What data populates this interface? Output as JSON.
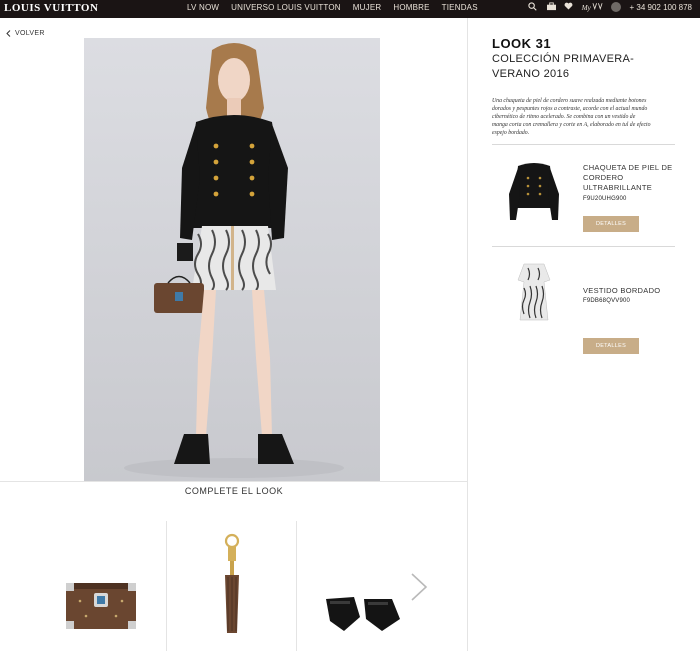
{
  "header": {
    "logo": "LOUIS VUITTON",
    "nav": [
      "LV NOW",
      "UNIVERSO LOUIS VUITTON",
      "MUJER",
      "HOMBRE",
      "TIENDAS"
    ],
    "icons": [
      "search-icon",
      "bag-icon",
      "heart-icon",
      "my-lv-icon",
      "globe-icon"
    ],
    "my_label": "My",
    "phone": "+ 34 902 100 878"
  },
  "back": {
    "label": "VOLVER",
    "icon": "chevron-left-icon"
  },
  "look": {
    "title": "LOOK 31",
    "collection": "COLECCIÓN PRIMAVERA-VERANO 2016",
    "description": "Una chaqueta de piel de cordero suave realzada mediante botones dorados y pespuntes rojos a contraste, acorde con el actual mundo cibernético de ritmo acelerado. Se combina con un vestido de manga corta con cremallera y corte en A, elaborado en tul de efecto espejo bordado."
  },
  "products": [
    {
      "name": "CHAQUETA DE PIEL DE CORDERO ULTRABRILLANTE",
      "code": "F9U20UHG900",
      "button": "DETALLES"
    },
    {
      "name": "VESTIDO BORDADO",
      "code": "F9DB68QVV900",
      "button": "DETALLES"
    }
  ],
  "complete_look": {
    "title": "COMPLETE EL LOOK",
    "items": [
      "petite-malle-bag",
      "bag-charm-tassel",
      "leather-fingerless-gloves"
    ]
  },
  "colors": {
    "topbar": "#1a1414",
    "accent_button": "#c8ad88"
  }
}
